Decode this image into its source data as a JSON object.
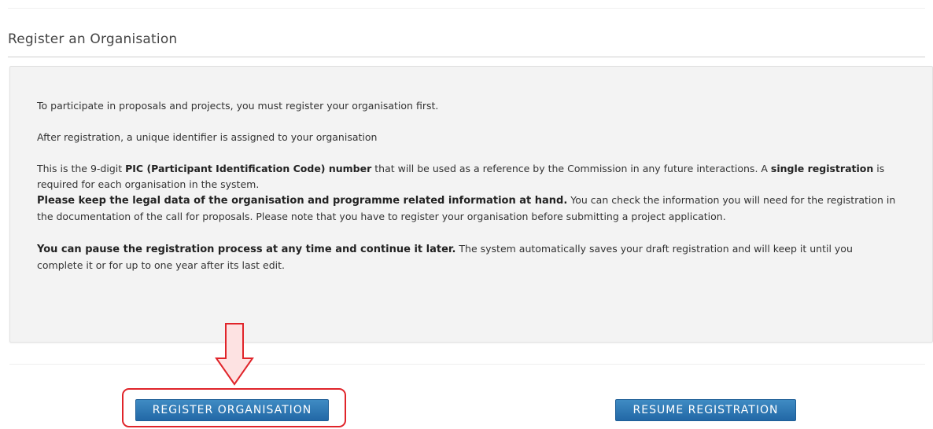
{
  "section": {
    "title": "Register an Organisation"
  },
  "info": {
    "p1": "To participate in proposals and projects, you must register your organisation first.",
    "p2": "After registration, a unique identifier is assigned to your organisation",
    "p3": {
      "pre": "This is the 9-digit ",
      "bold1": "PIC (Participant Identification Code) number",
      "mid": " that will be used as a reference by the Commission in any future interactions. A ",
      "bold2": "single registration",
      "post": " is required for each organisation in the system."
    },
    "p4": {
      "bold": "Please keep the legal data of the organisation and programme related information at hand.",
      "text": " You can check the information you will need for the registration in the documentation of the call for proposals. Please note that you have to register your organisation before submitting a project application."
    },
    "p5": {
      "bold": "You can pause the registration process at any time and continue it later.",
      "text": " The system automatically saves your draft registration and will keep it until you complete it or for up to one year after its last edit."
    }
  },
  "actions": {
    "register_label": "REGISTER ORGANISATION",
    "resume_label": "RESUME REGISTRATION"
  },
  "colors": {
    "button": "#2b74b1",
    "highlight": "#e0242a",
    "arrow_fill": "#fde2e2"
  },
  "annotations": {
    "arrow_icon": "down-arrow-icon"
  }
}
